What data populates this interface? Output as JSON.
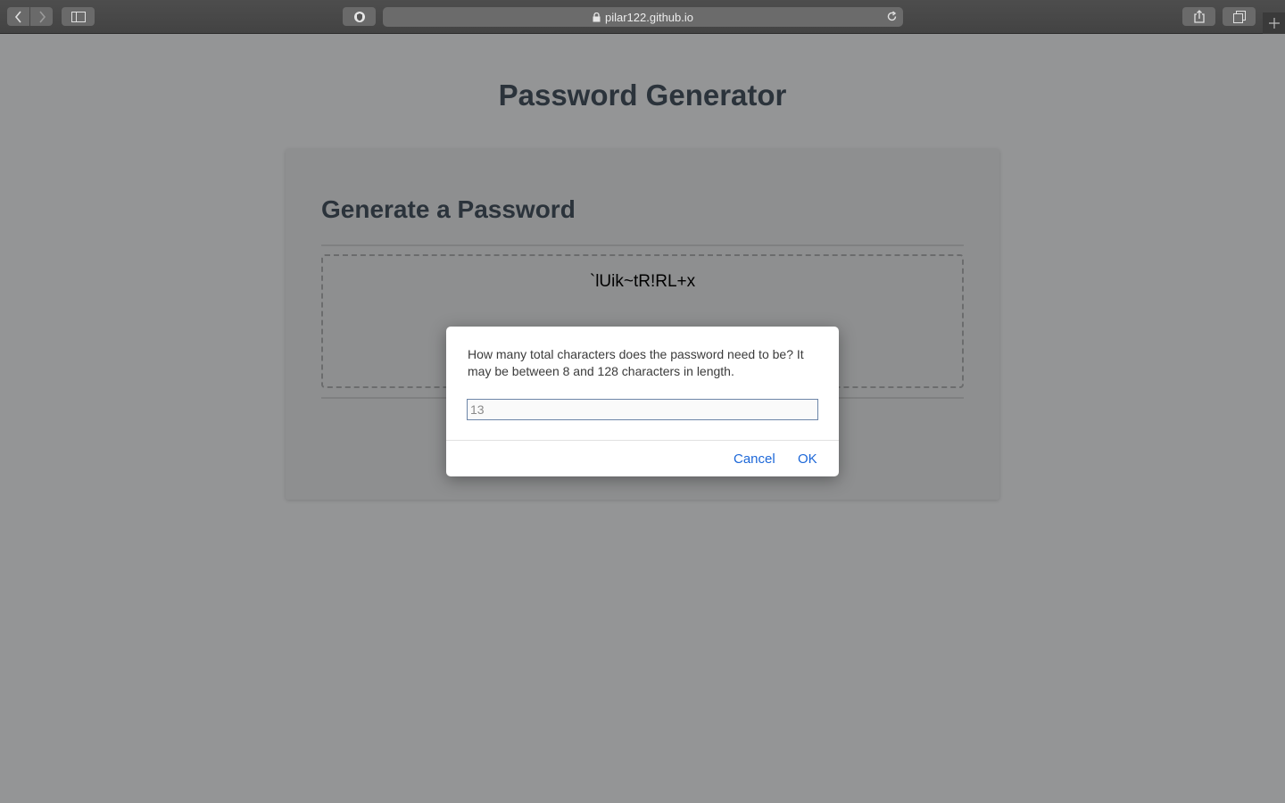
{
  "browser": {
    "url": "pilar122.github.io"
  },
  "page": {
    "title": "Password Generator",
    "card": {
      "header": "Generate a Password",
      "password": "`lUik~tR!RL+x"
    }
  },
  "dialog": {
    "message": "How many total characters does the password need to be? It may be between 8 and 128 characters in length.",
    "input_value": "13",
    "cancel_label": "Cancel",
    "ok_label": "OK"
  },
  "colors": {
    "heading": "#2b333b",
    "dialog_button": "#1c67d8",
    "overlay_background": "#949596"
  }
}
